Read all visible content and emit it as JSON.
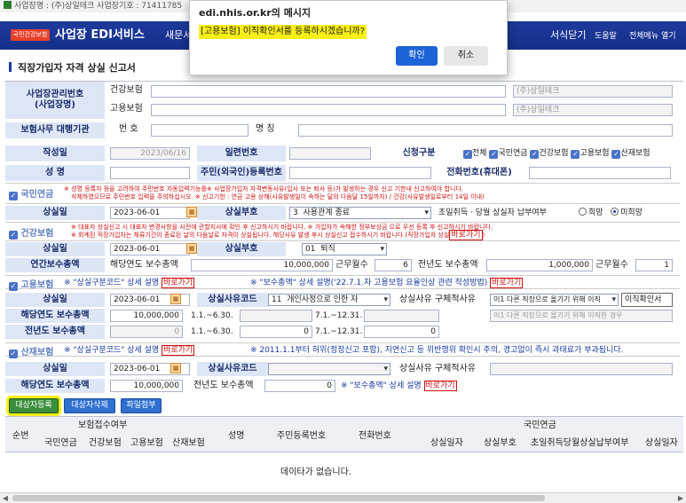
{
  "topbar": {
    "text": "사업장명 : (주)상일테크 사업장기호 : 71411785"
  },
  "nav": {
    "logo": "국민건강보험",
    "brand": "사업장 EDI서비스",
    "menu1": "새문서",
    "menu_close": "서식닫기",
    "help": "도움말",
    "menu_all": "전체메뉴 열기"
  },
  "page": {
    "title": "직장가입자 자격 상실 신고서"
  },
  "dialog": {
    "title": "edi.nhis.or.kr의 메시지",
    "message": "[고용보험] 이직확인서를 등록하시겠습니까?",
    "ok": "확인",
    "cancel": "취소"
  },
  "biz": {
    "label_no": "사업장관리번호\n(사업장명)",
    "health": "건강보험",
    "employ": "고용보험",
    "company_health": "(주)상일테크",
    "company_employ": "(주)상일테크",
    "agency_label": "보험사무 대행기관",
    "no_label": "번 호",
    "name_label": "명 칭"
  },
  "info": {
    "date_label": "작성일",
    "date_value": "2023/06/16",
    "serial_label": "일련번호",
    "apply_label": "신청구분",
    "apply_options": [
      "전체",
      "국민연금",
      "건강보험",
      "고용보험",
      "산재보험"
    ],
    "name_label": "성 명",
    "rrn_label": "주민(외국인)등록번호",
    "phone_label": "전화번호(휴대폰)"
  },
  "pension": {
    "title": "국민연금",
    "note1": "※ 성명 등록자 등을 고려하여 주민번호 자동입력기능를※ 사업장가입자 자격변동사유(입사 또는 퇴사 등)가 발생하는 경우 신고 기한내 신고하여야 합니다.",
    "note2": "삭제하였으므로 주민번호 입력을 주의하십시오.   ※ 신고기한 : 연금 고용 상해(사유발생일이 속하는 달의 다음달 15일까지) / 건강(사유발생일로부터 14일 이내)",
    "loss_date_label": "상실일",
    "loss_date": "2023-06-01",
    "loss_code_label": "상실부호",
    "loss_code": "3",
    "loss_code_text": "사용관계 종료",
    "first_month_label": "초일취득 · 당월 상실자 납부여부",
    "opt_yes": "희망",
    "opt_no": "미희망"
  },
  "health": {
    "title": "건강보험",
    "note1": "※ 대표자 상실신고 시 대표자 변경사항을 사전에 관할지사에 확인 후 신고하시기 바랍니다.      ※ 가입자가 속해한 정부보상금 으로 우선 등록 후 신고하시기 바랍니다.",
    "note2": "※ 회계된 직장가입자는 체류기간이 종료된 날의 다음날로 자격이 상실됩니다. 해당사유 발생 후시 상실신고 접수하시기 바랍니다.(직장가입자 상실",
    "link": "바로가기",
    "loss_date_label": "상실일",
    "loss_date": "2023-06-01",
    "loss_code_label": "상실부호",
    "loss_code": "01",
    "loss_code_text": "퇴직",
    "annual_label": "연간보수총액",
    "cur_year_label": "해당연도 보수총액",
    "cur_year_amount": "10,000,000",
    "months_label": "근무월수",
    "cur_months": "6",
    "prev_year_label": "전년도 보수총액",
    "prev_amount": "1,000,000",
    "prev_months": "1"
  },
  "employ": {
    "title": "고용보험",
    "guide1": "※ \"상실구분코드\" 상세 설명",
    "link1": "바로가기",
    "guide2": "※ \"보수총액\" 상세 설명('22.7.1.자 고용보험 요율인상 관련 작성방법)",
    "link2": "바로가기",
    "loss_date_label": "상실일",
    "loss_date": "2023-06-01",
    "reason_label": "상실사유코드",
    "reason_code": "11",
    "reason_text": "개인사정으로 인한 자",
    "detail_label": "상실사유 구체적사유",
    "detail_text": "이1 다른 직장으로 옮기기 위해 이직",
    "detail_text2": "이1 다른 직장으로 옮기기 위해 이직한 경우",
    "btn_cert": "이직확인서",
    "cur_year_label": "해당연도 보수총액",
    "cur_amount": "10,000,000",
    "period1": "1.1.~6.30.",
    "period2": "7.1.~12.31.",
    "prev_year_label": "전년도 보수총액",
    "prev_amount": "0",
    "prev_period1": "1.1.~6.30.",
    "prev_p1_value": "0",
    "prev_period2": "7.1.~12.31.",
    "prev_p2_value": "0"
  },
  "injury": {
    "title": "산재보험",
    "guide1": "※ \"상실구분코드\" 상세 설명",
    "link1": "바로가기",
    "warning": "※ 2011.1.1부터 허위(정정신고 포함), 지연신고 등 위반행위 확인시 주의, 경고없이 즉시 과태료가 부과됩니다.",
    "loss_date_label": "상실일",
    "loss_date": "2023-06-01",
    "reason_label": "상실사유코드",
    "detail_label": "상실사유 구체적사유",
    "cur_year_label": "해당연도 보수총액",
    "cur_amount": "10,000,000",
    "prev_year_label": "전년도 보수총액",
    "prev_amount": "0",
    "guide2": "※ \"보수총액\" 상세 설명",
    "link2": "바로가기"
  },
  "actions": {
    "add": "대상자등록",
    "delete": "대상자삭제",
    "attach": "파일첨부"
  },
  "table": {
    "col_no": "순번",
    "col_insurance": "보험접수여부",
    "col_sub": [
      "국민연금",
      "건강보험",
      "고용보험",
      "산재보험"
    ],
    "col_name": "성명",
    "col_rrn": "주민등록번호",
    "col_phone": "전화번호",
    "col_pension": "국민연금",
    "col_pension_sub": [
      "상실일자",
      "상실부호",
      "초일취득당월상실납부여부",
      "상실일자"
    ],
    "empty": "데이타가 없습니다."
  }
}
